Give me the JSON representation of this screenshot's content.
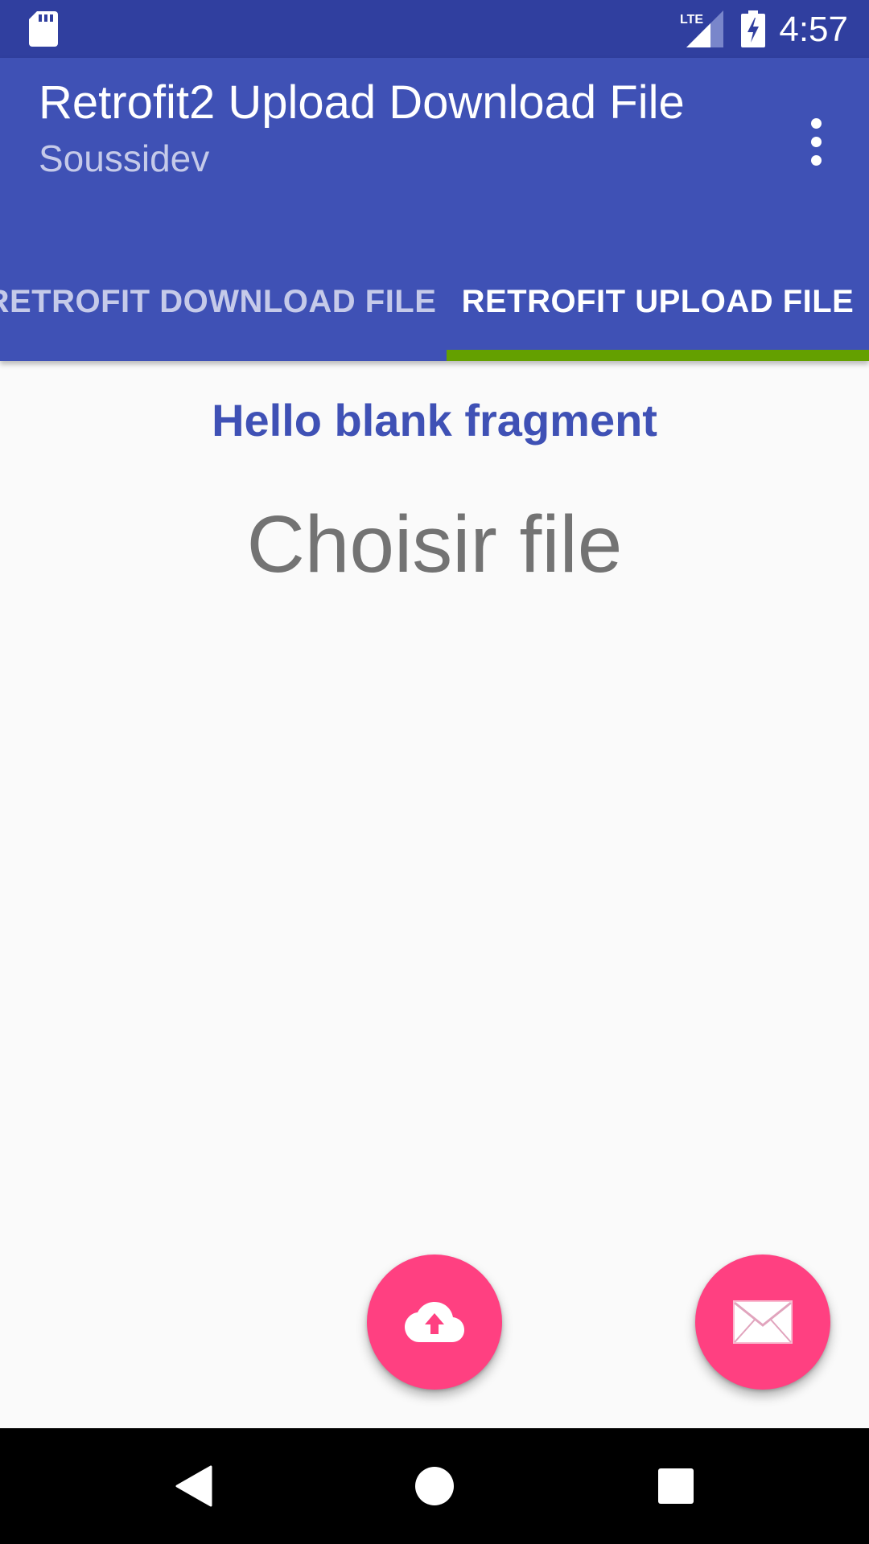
{
  "status_bar": {
    "time": "4:57",
    "network_label": "LTE",
    "icons": [
      "sd-card-icon",
      "lte-signal-icon",
      "battery-charging-icon"
    ]
  },
  "app_bar": {
    "title": "Retrofit2 Upload Download File",
    "subtitle": "Soussidev",
    "menu_icon": "more-vert-icon"
  },
  "tabs": [
    {
      "label": "RETROFIT DOWNLOAD FILE",
      "selected": false
    },
    {
      "label": "RETROFIT UPLOAD FILE",
      "selected": true
    }
  ],
  "content": {
    "heading": "Hello blank fragment",
    "choose_button_label": "Choisir file"
  },
  "fabs": [
    {
      "icon": "cloud-upload-icon"
    },
    {
      "icon": "mail-icon"
    }
  ],
  "navigation_bar": {
    "icons": [
      "back-icon",
      "home-icon",
      "recents-icon"
    ]
  },
  "colors": {
    "status_bar": "#303f9f",
    "primary": "#3f51b5",
    "accent": "#ff4081",
    "tab_indicator": "#64a000",
    "heading_text": "#3f51b5",
    "button_text": "#737373"
  }
}
